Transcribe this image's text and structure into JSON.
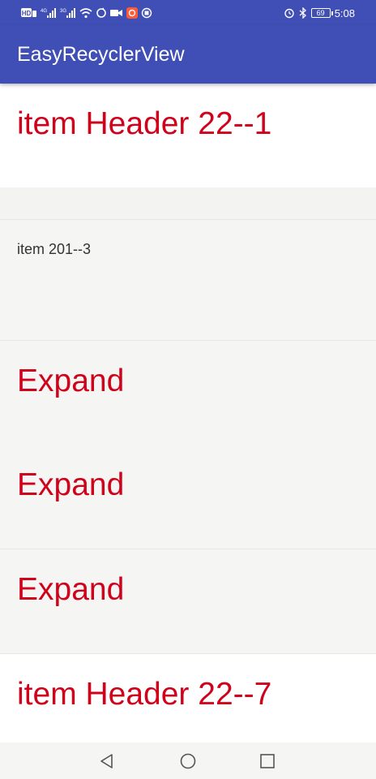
{
  "status_bar": {
    "time": "5:08",
    "battery_level": "69",
    "left_icons": [
      "hd-icon",
      "signal-4g-icon",
      "signal-3g-icon",
      "wifi-icon",
      "sync-icon",
      "video-icon",
      "app-notification-icon",
      "record-icon"
    ],
    "right_icons": [
      "alarm-icon",
      "bluetooth-icon",
      "battery-icon"
    ]
  },
  "app_bar": {
    "title": "EasyRecyclerView",
    "color": "#3f4fb5"
  },
  "list": {
    "accent_color": "#d0021b",
    "items": [
      {
        "kind": "header",
        "text": "item Header 22--1"
      },
      {
        "kind": "item",
        "text": "item 201--3"
      },
      {
        "kind": "expand",
        "text": "Expand"
      },
      {
        "kind": "expand",
        "text": "Expand"
      },
      {
        "kind": "expand",
        "text": "Expand"
      },
      {
        "kind": "header",
        "text": "item Header 22--7"
      }
    ]
  },
  "nav_bar": {
    "buttons": [
      "back-icon",
      "home-icon",
      "recents-icon"
    ]
  }
}
